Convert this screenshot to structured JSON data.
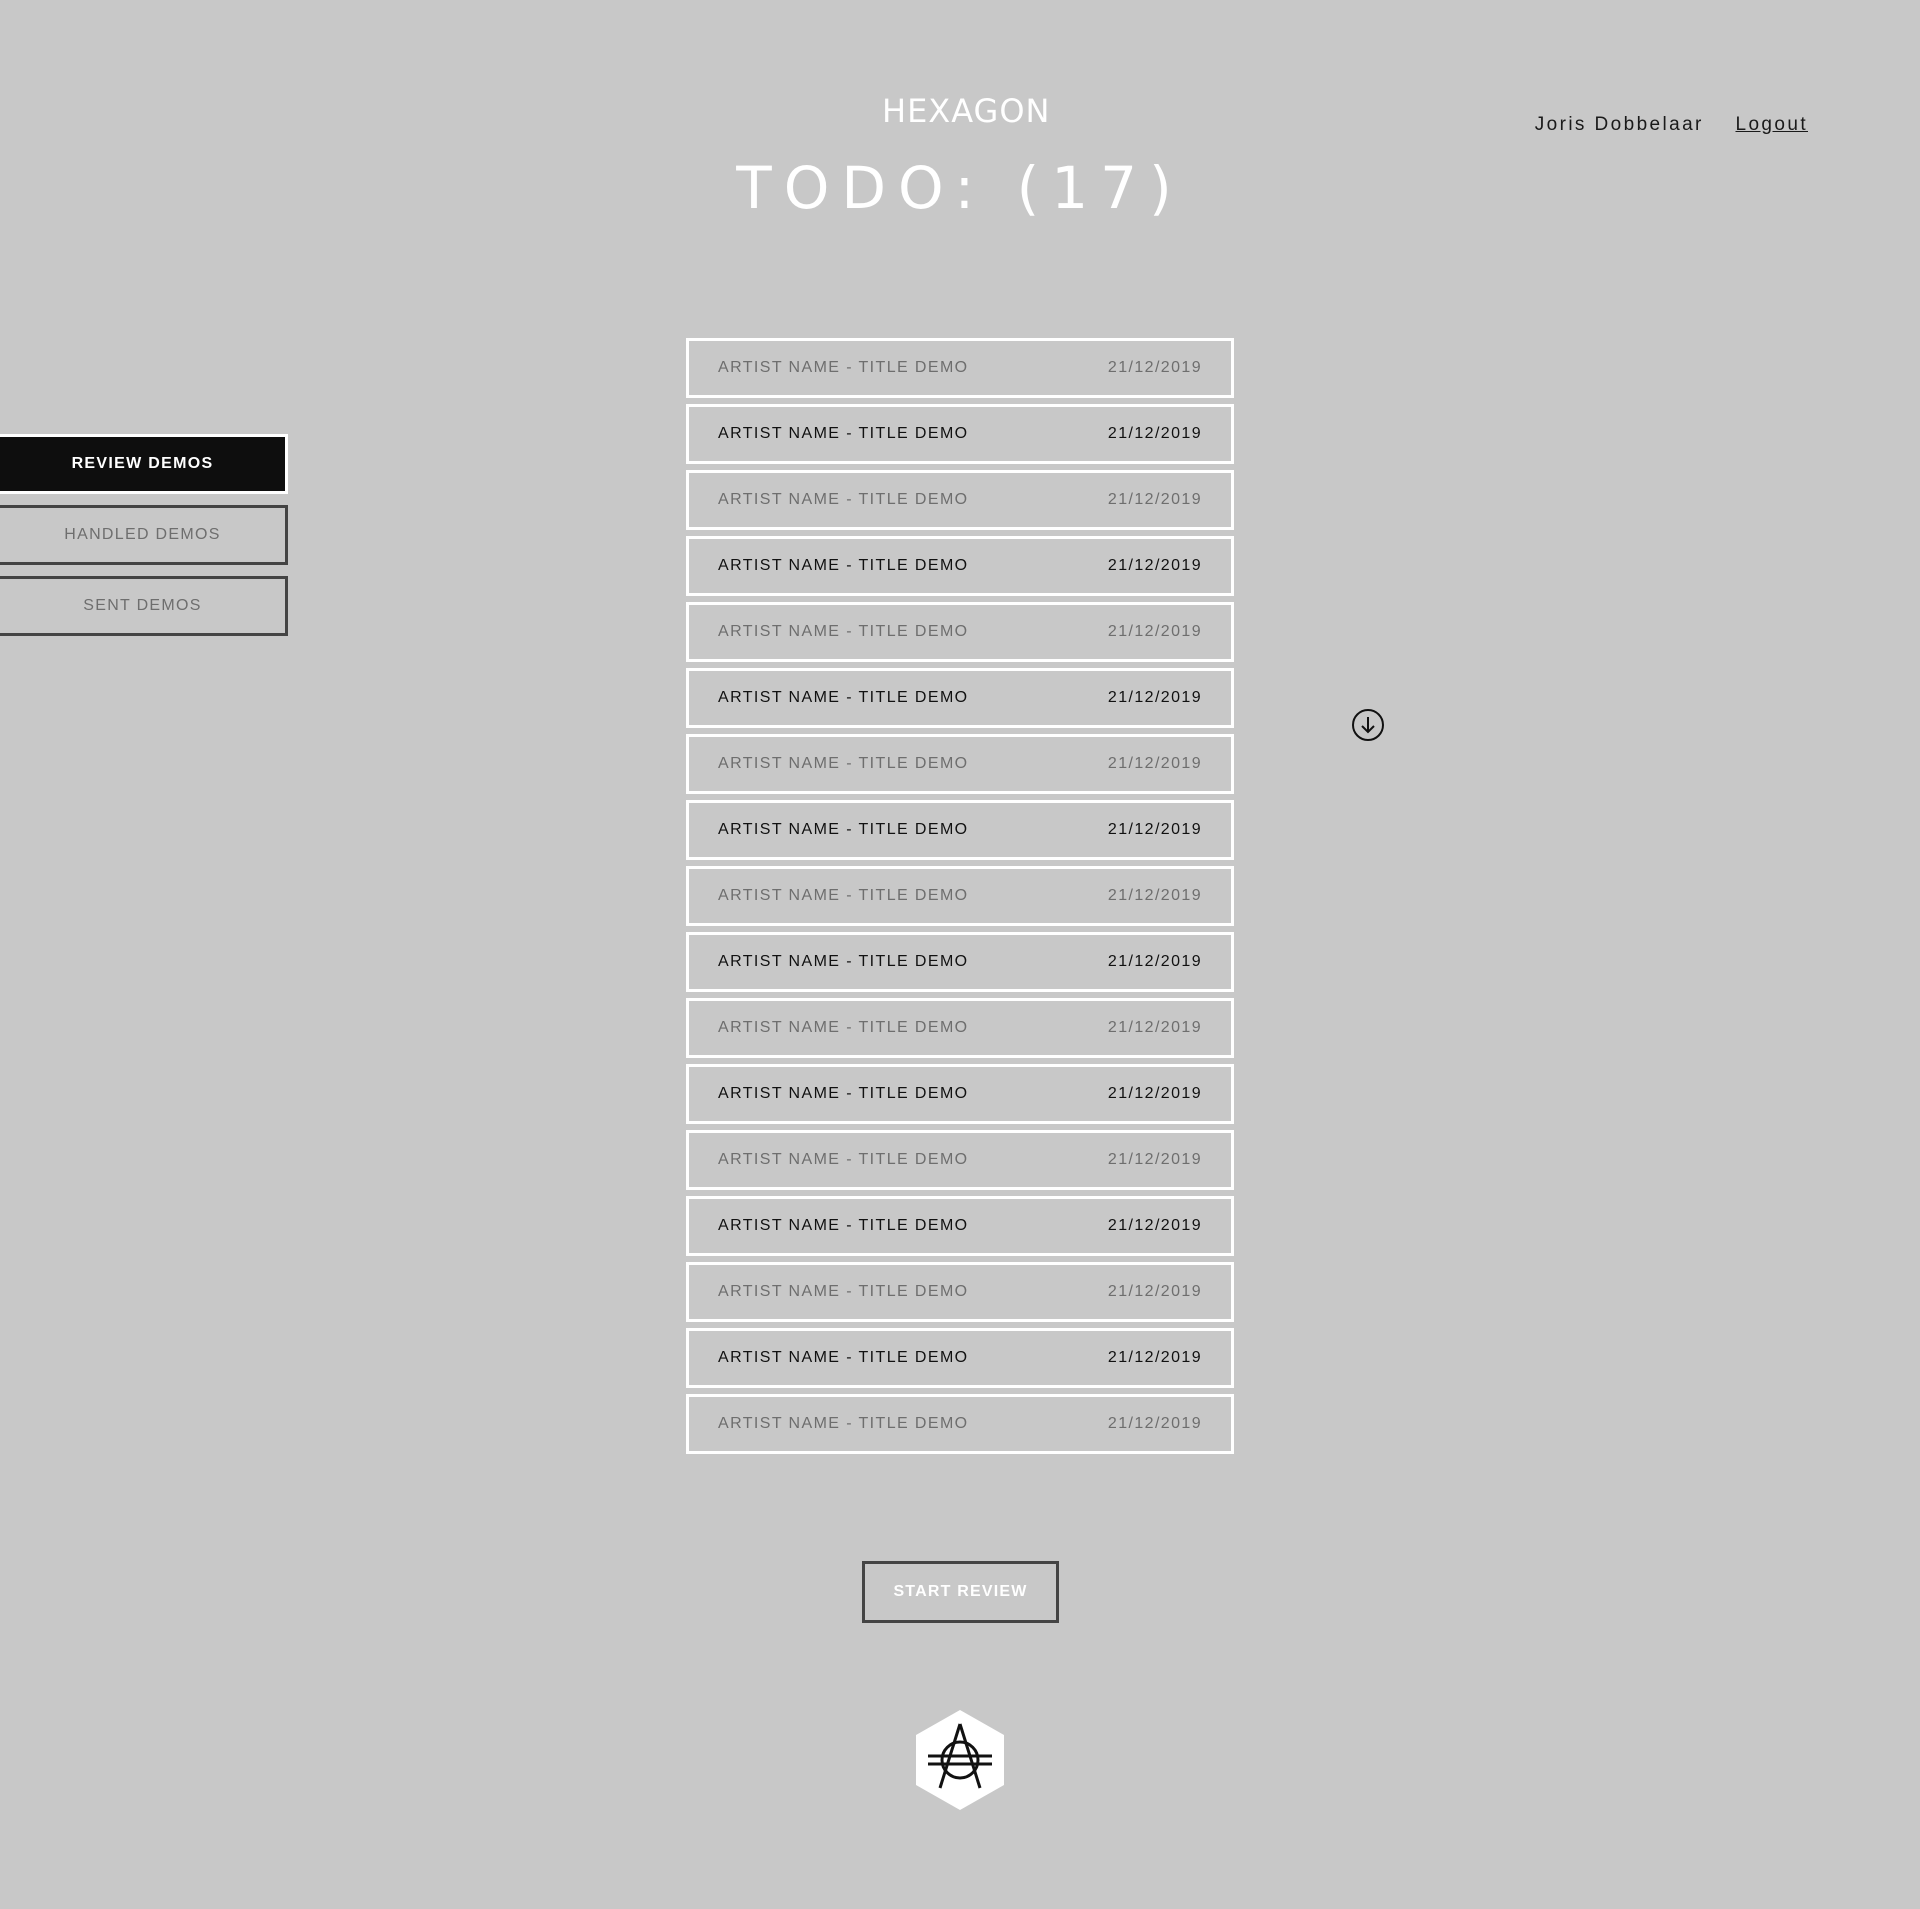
{
  "header": {
    "logo_text": "HEXAGON",
    "title": "TODO: (17)"
  },
  "user": {
    "name": "Joris Dobbelaar",
    "logout_label": "Logout"
  },
  "sidebar": {
    "items": [
      {
        "label": "REVIEW DEMOS",
        "active": true
      },
      {
        "label": "HANDLED DEMOS",
        "active": false
      },
      {
        "label": "SENT DEMOS",
        "active": false
      }
    ]
  },
  "demos": [
    {
      "title": "ARTIST NAME - TITLE DEMO",
      "date": "21/12/2019"
    },
    {
      "title": "ARTIST NAME - TITLE DEMO",
      "date": "21/12/2019"
    },
    {
      "title": "ARTIST NAME - TITLE DEMO",
      "date": "21/12/2019"
    },
    {
      "title": "ARTIST NAME - TITLE DEMO",
      "date": "21/12/2019"
    },
    {
      "title": "ARTIST NAME - TITLE DEMO",
      "date": "21/12/2019"
    },
    {
      "title": "ARTIST NAME - TITLE DEMO",
      "date": "21/12/2019"
    },
    {
      "title": "ARTIST NAME - TITLE DEMO",
      "date": "21/12/2019"
    },
    {
      "title": "ARTIST NAME - TITLE DEMO",
      "date": "21/12/2019"
    },
    {
      "title": "ARTIST NAME - TITLE DEMO",
      "date": "21/12/2019"
    },
    {
      "title": "ARTIST NAME - TITLE DEMO",
      "date": "21/12/2019"
    },
    {
      "title": "ARTIST NAME - TITLE DEMO",
      "date": "21/12/2019"
    },
    {
      "title": "ARTIST NAME - TITLE DEMO",
      "date": "21/12/2019"
    },
    {
      "title": "ARTIST NAME - TITLE DEMO",
      "date": "21/12/2019"
    },
    {
      "title": "ARTIST NAME - TITLE DEMO",
      "date": "21/12/2019"
    },
    {
      "title": "ARTIST NAME - TITLE DEMO",
      "date": "21/12/2019"
    },
    {
      "title": "ARTIST NAME - TITLE DEMO",
      "date": "21/12/2019"
    },
    {
      "title": "ARTIST NAME - TITLE DEMO",
      "date": "21/12/2019"
    }
  ],
  "actions": {
    "start_review_label": "START REVIEW"
  },
  "icons": {
    "download": "download-circle-icon",
    "footer_logo": "hexagon-emblem-icon"
  },
  "colors": {
    "background": "#c8c8c8",
    "active_nav": "#0e0e0e",
    "row_border": "#ffffff",
    "muted_text": "#6e6e6e",
    "dark_text": "#111111"
  }
}
